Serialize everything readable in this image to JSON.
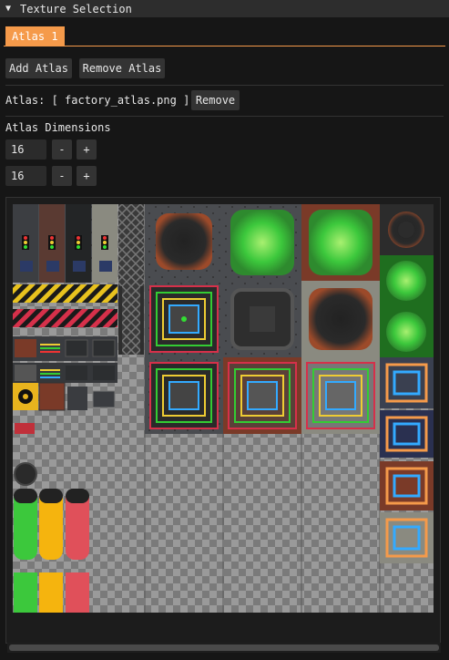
{
  "window": {
    "title": "Texture Selection",
    "collapse_icon": "triangle-down-icon"
  },
  "tabs": [
    {
      "label": "Atlas 1",
      "active": true
    }
  ],
  "toolbar": {
    "add_label": "Add Atlas",
    "remove_label": "Remove Atlas"
  },
  "atlas_row": {
    "label": "Atlas: [ factory_atlas.png ]",
    "remove_label": "Remove"
  },
  "dimensions": {
    "label": "Atlas Dimensions",
    "width_value": "16",
    "height_value": "16",
    "minus": "-",
    "plus": "+"
  },
  "colors": {
    "accent": "#f59a4a",
    "bg": "#161616",
    "button": "#333333",
    "frame": "#2b2b2b"
  },
  "atlas_image": {
    "name": "factory_atlas.png"
  }
}
